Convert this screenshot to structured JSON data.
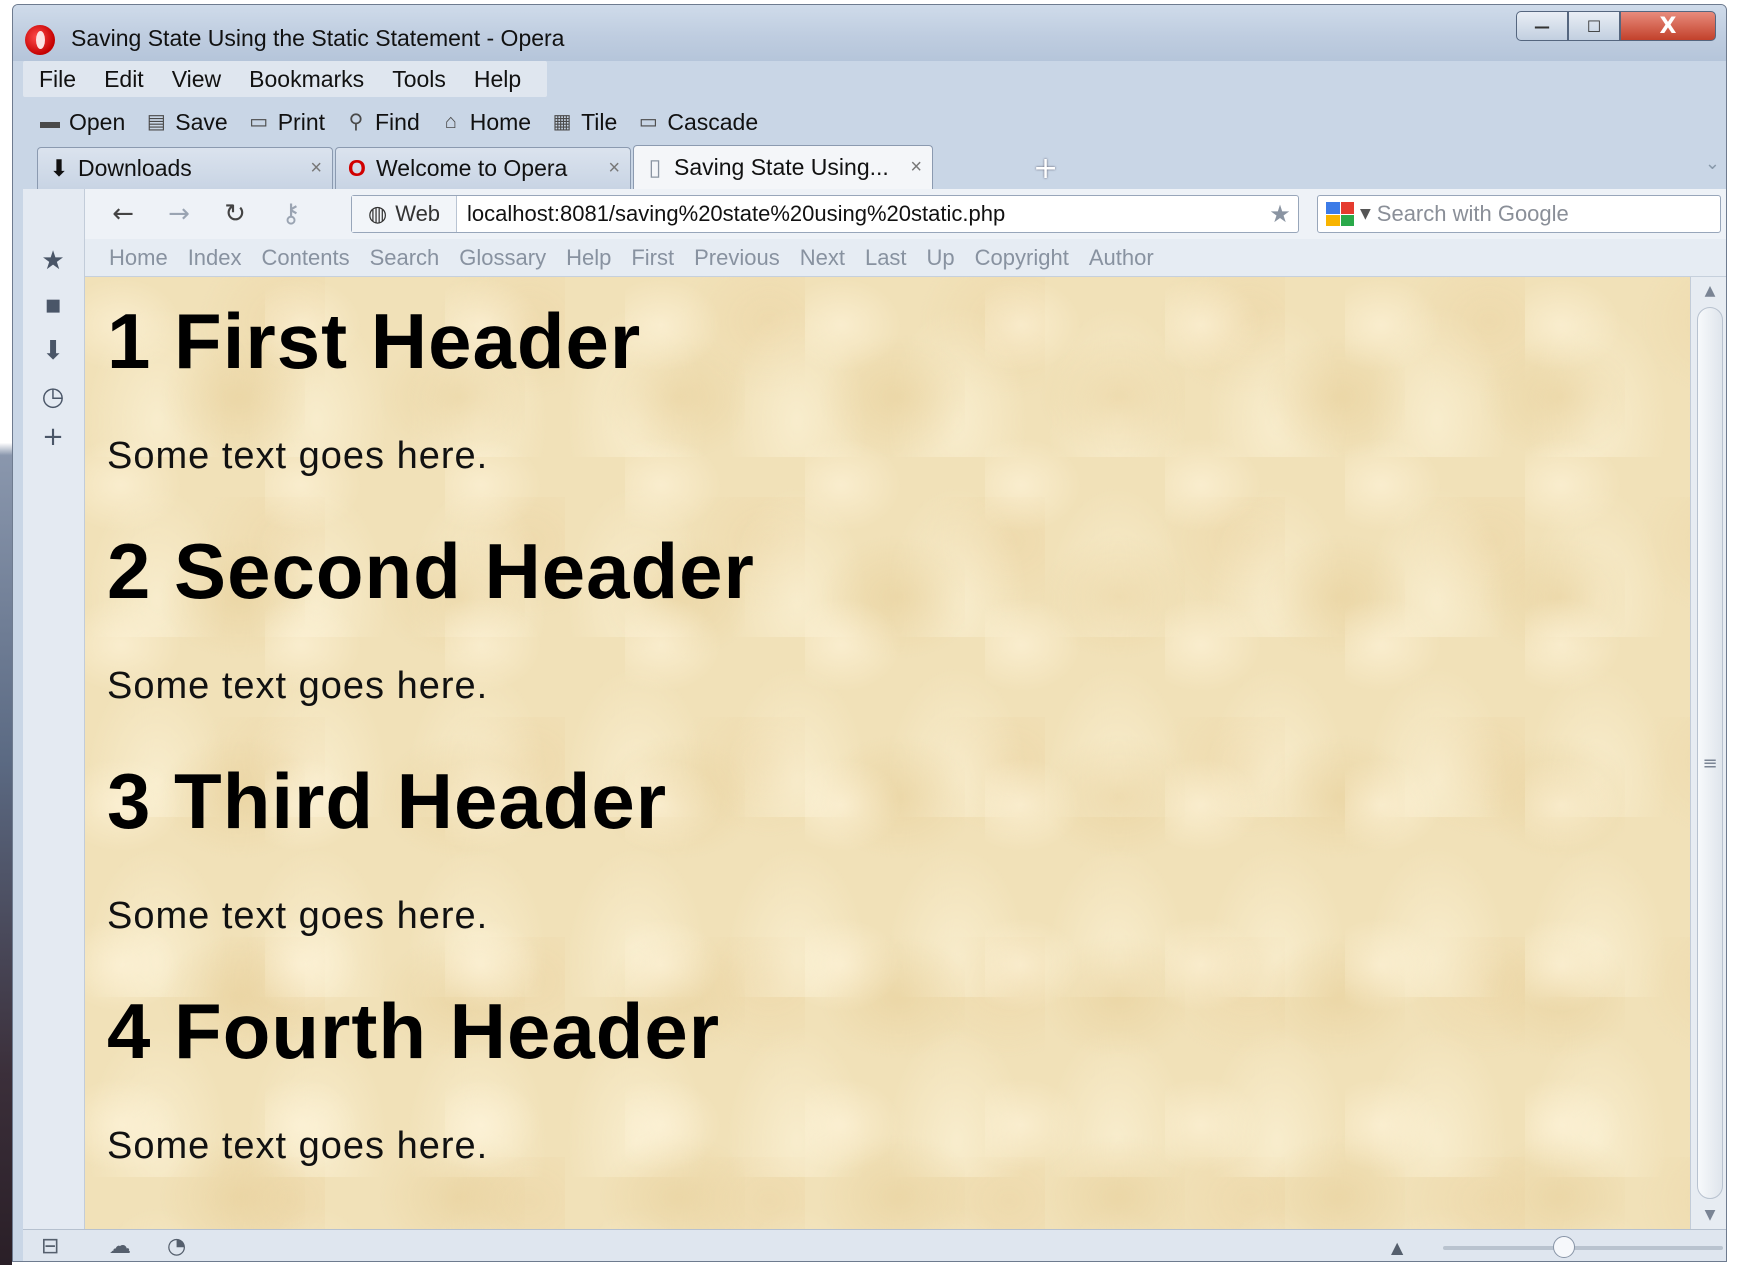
{
  "window": {
    "title": "Saving State Using the Static Statement - Opera",
    "controls": {
      "minimize": "—",
      "maximize": "☐",
      "close": "X"
    }
  },
  "menu": [
    "File",
    "Edit",
    "View",
    "Bookmarks",
    "Tools",
    "Help"
  ],
  "toolbar": [
    {
      "label": "Open",
      "icon": "folder-icon"
    },
    {
      "label": "Save",
      "icon": "save-icon"
    },
    {
      "label": "Print",
      "icon": "printer-icon"
    },
    {
      "label": "Find",
      "icon": "search-icon"
    },
    {
      "label": "Home",
      "icon": "home-icon"
    },
    {
      "label": "Tile",
      "icon": "tile-icon"
    },
    {
      "label": "Cascade",
      "icon": "cascade-icon"
    }
  ],
  "tabs": [
    {
      "label": "Downloads",
      "icon": "download-icon",
      "active": false
    },
    {
      "label": "Welcome to Opera",
      "icon": "opera-icon",
      "active": false
    },
    {
      "label": "Saving State Using...",
      "icon": "page-icon",
      "active": true
    }
  ],
  "address": {
    "prefix": "Web",
    "url": "localhost:8081/saving%20state%20using%20static.php"
  },
  "search": {
    "placeholder": "Search with Google"
  },
  "navlinks": [
    "Home",
    "Index",
    "Contents",
    "Search",
    "Glossary",
    "Help",
    "First",
    "Previous",
    "Next",
    "Last",
    "Up",
    "Copyright",
    "Author"
  ],
  "page": {
    "sections": [
      {
        "heading": "1 First Header",
        "text": "Some text goes here."
      },
      {
        "heading": "2 Second Header",
        "text": "Some text goes here."
      },
      {
        "heading": "3 Third Header",
        "text": "Some text goes here."
      },
      {
        "heading": "4 Fourth Header",
        "text": "Some text goes here."
      }
    ]
  },
  "colors": {
    "page_background": "#f1e1b8",
    "chrome": "#c9d6e6",
    "close_button": "#c2412b"
  }
}
